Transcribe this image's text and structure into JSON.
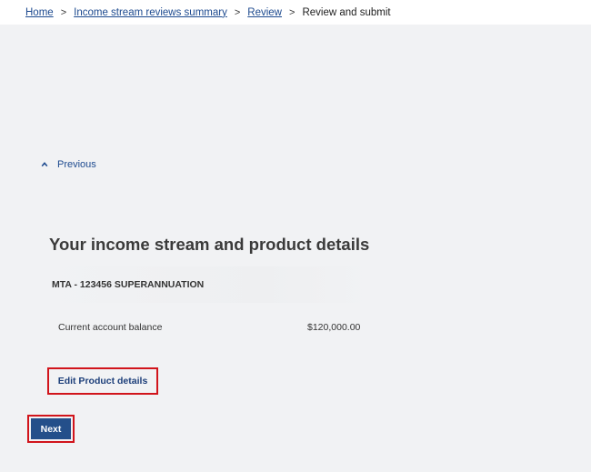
{
  "breadcrumb": {
    "items": [
      {
        "label": "Home"
      },
      {
        "label": "Income stream reviews summary"
      },
      {
        "label": "Review"
      }
    ],
    "separator": ">",
    "current": "Review and submit"
  },
  "previous": {
    "label": "Previous",
    "icon": "chevron-up-icon"
  },
  "section": {
    "title": "Your income stream and product details",
    "product_header": "MTA - 123456 SUPERANNUATION",
    "balance_label": "Current account balance",
    "balance_value": "$120,000.00",
    "edit_label": "Edit Product details"
  },
  "actions": {
    "next_label": "Next"
  },
  "colors": {
    "link": "#1d4a8f",
    "primary_button": "#244f8a",
    "highlight_border": "#d1141b",
    "background": "#f1f2f4"
  }
}
